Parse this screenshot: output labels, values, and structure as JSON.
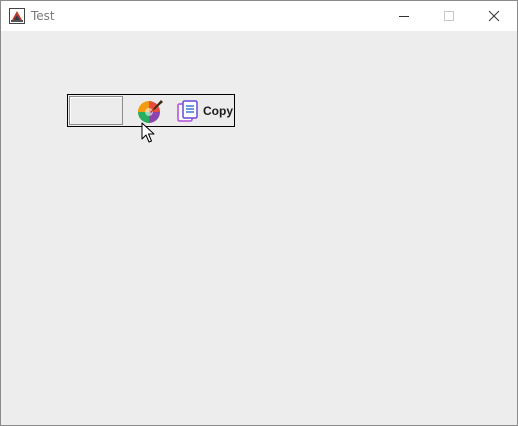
{
  "window": {
    "title": "Test",
    "icons": {
      "app": "java-app-icon",
      "minimize": "minimize-icon",
      "maximize": "maximize-icon",
      "close": "close-icon"
    }
  },
  "toolbar": {
    "color_swatch": "color-swatch",
    "palette_icon": "palette-icon",
    "copy_icon": "copy-icon",
    "copy_label": "Copy"
  },
  "colors": {
    "window_background": "#ededed",
    "titlebar_background": "#ffffff",
    "toolbar_border": "#000000"
  }
}
